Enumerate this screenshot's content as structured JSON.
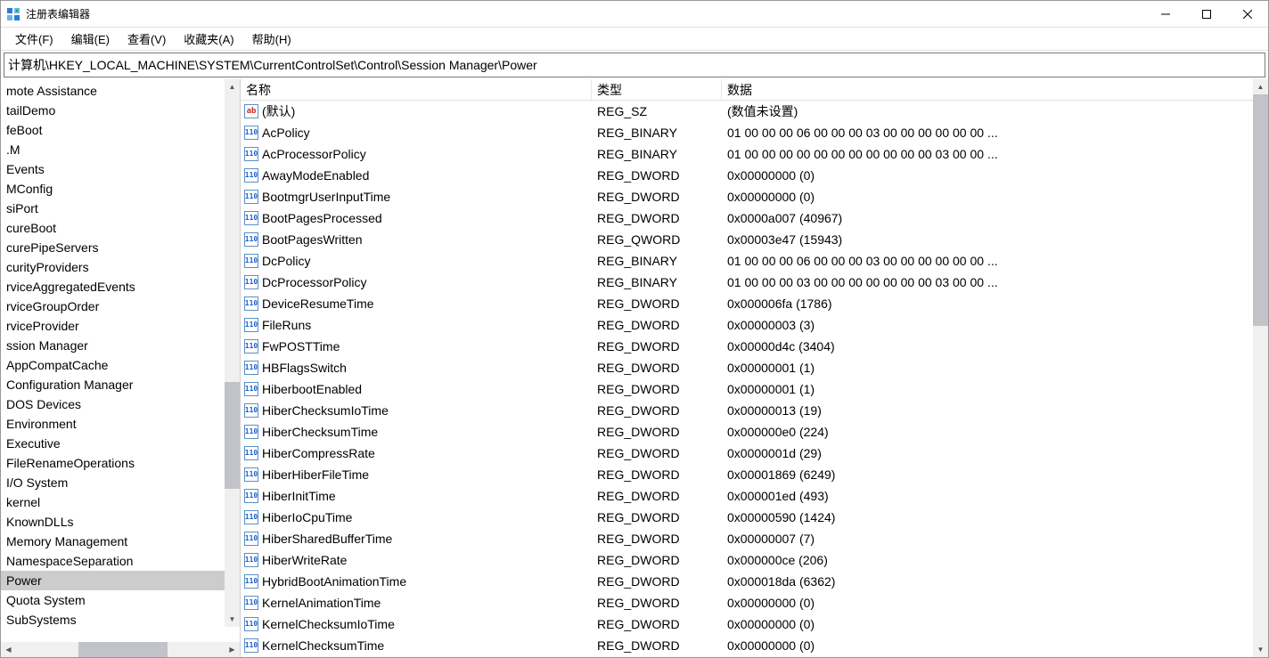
{
  "window": {
    "title": "注册表编辑器"
  },
  "menu": {
    "file": "文件(F)",
    "edit": "编辑(E)",
    "view": "查看(V)",
    "favorites": "收藏夹(A)",
    "help": "帮助(H)"
  },
  "address": "计算机\\HKEY_LOCAL_MACHINE\\SYSTEM\\CurrentControlSet\\Control\\Session Manager\\Power",
  "tree": {
    "items": [
      "mote Assistance",
      "tailDemo",
      "feBoot",
      ".M",
      "Events",
      "MConfig",
      "siPort",
      "cureBoot",
      "curePipeServers",
      "curityProviders",
      "rviceAggregatedEvents",
      "rviceGroupOrder",
      "rviceProvider",
      "ssion Manager",
      "AppCompatCache",
      "Configuration Manager",
      "DOS Devices",
      "Environment",
      "Executive",
      "FileRenameOperations",
      "I/O System",
      "kernel",
      "KnownDLLs",
      "Memory Management",
      "NamespaceSeparation",
      "Power",
      "Quota System",
      "SubSystems"
    ],
    "selectedIndex": 25
  },
  "columns": {
    "name": "名称",
    "type": "类型",
    "data": "数据"
  },
  "values": [
    {
      "icon": "str",
      "name": "(默认)",
      "type": "REG_SZ",
      "data": "(数值未设置)"
    },
    {
      "icon": "bin",
      "name": "AcPolicy",
      "type": "REG_BINARY",
      "data": "01 00 00 00 06 00 00 00 03 00 00 00 00 00 00 ..."
    },
    {
      "icon": "bin",
      "name": "AcProcessorPolicy",
      "type": "REG_BINARY",
      "data": "01 00 00 00 00 00 00 00 00 00 00 00 03 00 00 ..."
    },
    {
      "icon": "bin",
      "name": "AwayModeEnabled",
      "type": "REG_DWORD",
      "data": "0x00000000 (0)"
    },
    {
      "icon": "bin",
      "name": "BootmgrUserInputTime",
      "type": "REG_DWORD",
      "data": "0x00000000 (0)"
    },
    {
      "icon": "bin",
      "name": "BootPagesProcessed",
      "type": "REG_DWORD",
      "data": "0x0000a007 (40967)"
    },
    {
      "icon": "bin",
      "name": "BootPagesWritten",
      "type": "REG_QWORD",
      "data": "0x00003e47 (15943)"
    },
    {
      "icon": "bin",
      "name": "DcPolicy",
      "type": "REG_BINARY",
      "data": "01 00 00 00 06 00 00 00 03 00 00 00 00 00 00 ..."
    },
    {
      "icon": "bin",
      "name": "DcProcessorPolicy",
      "type": "REG_BINARY",
      "data": "01 00 00 00 03 00 00 00 00 00 00 00 03 00 00 ..."
    },
    {
      "icon": "bin",
      "name": "DeviceResumeTime",
      "type": "REG_DWORD",
      "data": "0x000006fa (1786)"
    },
    {
      "icon": "bin",
      "name": "FileRuns",
      "type": "REG_DWORD",
      "data": "0x00000003 (3)"
    },
    {
      "icon": "bin",
      "name": "FwPOSTTime",
      "type": "REG_DWORD",
      "data": "0x00000d4c (3404)"
    },
    {
      "icon": "bin",
      "name": "HBFlagsSwitch",
      "type": "REG_DWORD",
      "data": "0x00000001 (1)"
    },
    {
      "icon": "bin",
      "name": "HiberbootEnabled",
      "type": "REG_DWORD",
      "data": "0x00000001 (1)"
    },
    {
      "icon": "bin",
      "name": "HiberChecksumIoTime",
      "type": "REG_DWORD",
      "data": "0x00000013 (19)"
    },
    {
      "icon": "bin",
      "name": "HiberChecksumTime",
      "type": "REG_DWORD",
      "data": "0x000000e0 (224)"
    },
    {
      "icon": "bin",
      "name": "HiberCompressRate",
      "type": "REG_DWORD",
      "data": "0x0000001d (29)"
    },
    {
      "icon": "bin",
      "name": "HiberHiberFileTime",
      "type": "REG_DWORD",
      "data": "0x00001869 (6249)"
    },
    {
      "icon": "bin",
      "name": "HiberInitTime",
      "type": "REG_DWORD",
      "data": "0x000001ed (493)"
    },
    {
      "icon": "bin",
      "name": "HiberIoCpuTime",
      "type": "REG_DWORD",
      "data": "0x00000590 (1424)"
    },
    {
      "icon": "bin",
      "name": "HiberSharedBufferTime",
      "type": "REG_DWORD",
      "data": "0x00000007 (7)"
    },
    {
      "icon": "bin",
      "name": "HiberWriteRate",
      "type": "REG_DWORD",
      "data": "0x000000ce (206)"
    },
    {
      "icon": "bin",
      "name": "HybridBootAnimationTime",
      "type": "REG_DWORD",
      "data": "0x000018da (6362)"
    },
    {
      "icon": "bin",
      "name": "KernelAnimationTime",
      "type": "REG_DWORD",
      "data": "0x00000000 (0)"
    },
    {
      "icon": "bin",
      "name": "KernelChecksumIoTime",
      "type": "REG_DWORD",
      "data": "0x00000000 (0)"
    },
    {
      "icon": "bin",
      "name": "KernelChecksumTime",
      "type": "REG_DWORD",
      "data": "0x00000000 (0)"
    }
  ]
}
